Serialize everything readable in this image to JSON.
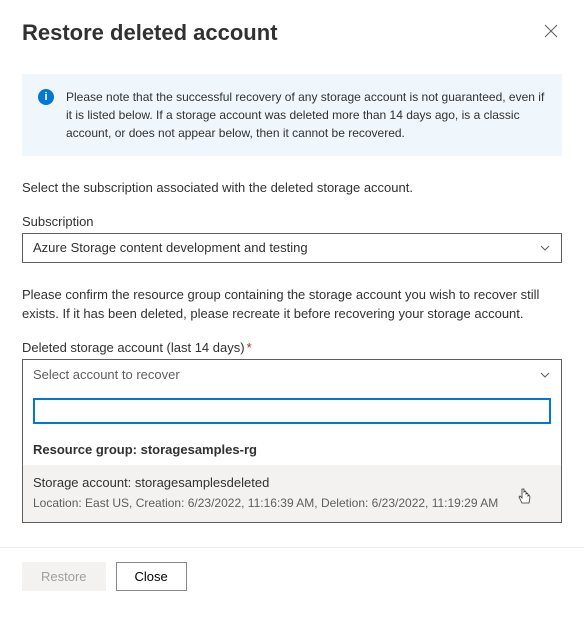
{
  "header": {
    "title": "Restore deleted account"
  },
  "info": {
    "text": "Please note that the successful recovery of any storage account is not guaranteed, even if it is listed below. If a storage account was deleted more than 14 days ago, is a classic account, or does not appear below, then it cannot be recovered."
  },
  "body": {
    "subscription_intro": "Select the subscription associated with the deleted storage account.",
    "subscription_label": "Subscription",
    "subscription_value": "Azure Storage content development and testing",
    "rg_intro": "Please confirm the resource group containing the storage account you wish to recover still exists. If it has been deleted, please recreate it before recovering your storage account.",
    "deleted_label": "Deleted storage account (last 14 days)",
    "deleted_placeholder": "Select account to recover",
    "group_label": "Resource group: storagesamples-rg",
    "account_label": "Storage account: storagesamplesdeleted",
    "account_meta": "Location: East US, Creation: 6/23/2022, 11:16:39 AM, Deletion: 6/23/2022, 11:19:29 AM"
  },
  "footer": {
    "restore_label": "Restore",
    "close_label": "Close"
  }
}
